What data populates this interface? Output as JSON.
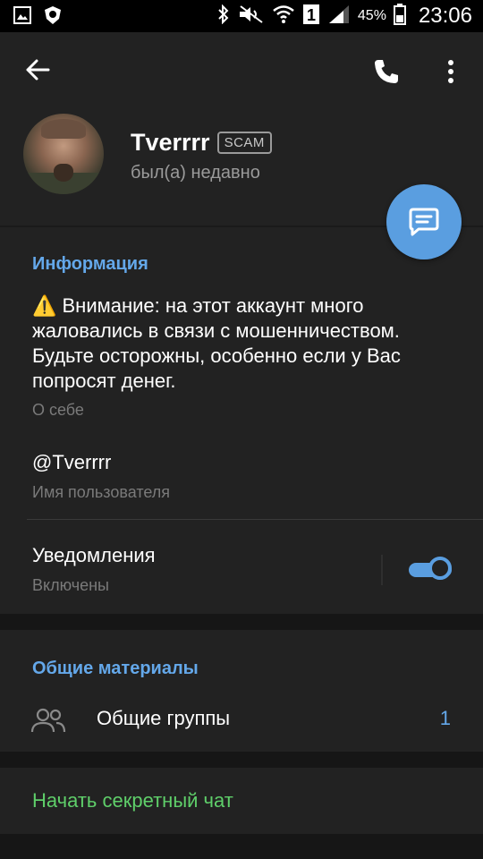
{
  "status_bar": {
    "battery": "45%",
    "time": "23:06",
    "icons": [
      "gallery-icon",
      "shield-app-icon",
      "bluetooth-icon",
      "mute-icon",
      "wifi-icon",
      "sim-1-icon",
      "signal-icon",
      "battery-icon"
    ]
  },
  "toolbar": {
    "back_icon": "arrow-left-icon",
    "call_icon": "phone-icon",
    "more_icon": "more-vertical-icon"
  },
  "profile": {
    "name": "Tverrrr",
    "badge": "SCAM",
    "status": "был(а) недавно",
    "fab_icon": "message-icon"
  },
  "info": {
    "section_title": "Информация",
    "bio": "⚠️ Внимание: на этот аккаунт много жаловались в связи с мошенничеством. Будьте осторожны, особенно если у Вас попросят денег.",
    "bio_label": "О себе",
    "username": "@Tverrrr",
    "username_label": "Имя пользователя",
    "notifications_label": "Уведомления",
    "notifications_state": "Включены",
    "notifications_on": true
  },
  "shared": {
    "section_title": "Общие материалы",
    "groups_label": "Общие группы",
    "groups_count": "1"
  },
  "secret_chat": {
    "label": "Начать секретный чат"
  },
  "colors": {
    "accent": "#5a9ee0",
    "section_title": "#64a8ea",
    "secret": "#5fcf6a"
  }
}
